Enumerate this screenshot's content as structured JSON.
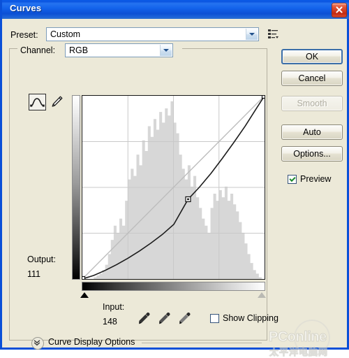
{
  "window": {
    "title": "Curves",
    "close_icon": "close-icon"
  },
  "preset": {
    "label": "Preset:",
    "value": "Custom",
    "menu_icon": "preset-menu-icon"
  },
  "channel": {
    "label": "Channel:",
    "value": "RGB"
  },
  "tools": {
    "curve_tool_icon": "curve-pen-icon",
    "pencil_tool_icon": "pencil-icon",
    "eyedropper_black_icon": "eyedropper-black-icon",
    "eyedropper_gray_icon": "eyedropper-gray-icon",
    "eyedropper_white_icon": "eyedropper-white-icon"
  },
  "readout": {
    "output_label": "Output:",
    "output_value": "111",
    "input_label": "Input:",
    "input_value": "148"
  },
  "show_clipping": {
    "label": "Show Clipping",
    "checked": false
  },
  "curve_display_options": {
    "label": "Curve Display Options",
    "expanded": false,
    "toggle_icon": "chevron-down-icon"
  },
  "buttons": {
    "ok": "OK",
    "cancel": "Cancel",
    "smooth": "Smooth",
    "auto": "Auto",
    "options": "Options...",
    "smooth_disabled": true
  },
  "preview": {
    "label": "Preview",
    "checked": true
  },
  "watermark": {
    "main": "PConline",
    "sub": "太平洋电脑网"
  },
  "colors": {
    "titlebar_blue": "#0a50d8",
    "dialog_face": "#ece9d8",
    "graph_bg": "#ffffff",
    "grid_line": "#c8c8c8",
    "histogram": "#d6d6d6",
    "curve_line": "#1a1a1a",
    "baseline": "#b4b4b4",
    "close_red": "#c22a12",
    "check_green": "#1d8b2f"
  },
  "chart_data": {
    "type": "line",
    "title": "Curves",
    "xlabel": "Input",
    "ylabel": "Output",
    "xlim": [
      0,
      255
    ],
    "ylim": [
      0,
      255
    ],
    "grid": true,
    "grid_divisions": 4,
    "legend": "none",
    "series": [
      {
        "name": "baseline-diagonal",
        "x": [
          0,
          255
        ],
        "y": [
          0,
          255
        ]
      },
      {
        "name": "tone-curve",
        "control_points": [
          [
            0,
            0
          ],
          [
            148,
            111
          ],
          [
            255,
            255
          ]
        ],
        "x": [
          0,
          16,
          32,
          48,
          64,
          80,
          96,
          112,
          128,
          148,
          164,
          180,
          196,
          212,
          228,
          244,
          255
        ],
        "y": [
          0,
          5,
          12,
          20,
          29,
          39,
          50,
          62,
          76,
          111,
          128,
          147,
          168,
          190,
          213,
          238,
          255
        ]
      }
    ],
    "annotations": [
      {
        "label": "selected-point",
        "x": 148,
        "y": 111
      },
      {
        "label": "black-point",
        "x": 0,
        "y": 0
      },
      {
        "label": "white-point",
        "x": 255,
        "y": 255
      }
    ],
    "histogram": {
      "name": "RGB luminance histogram",
      "bins": 64,
      "values": [
        0,
        0,
        0,
        0,
        1,
        2,
        3,
        5,
        8,
        14,
        22,
        30,
        26,
        34,
        30,
        44,
        56,
        62,
        58,
        70,
        64,
        78,
        72,
        86,
        80,
        90,
        84,
        94,
        88,
        96,
        92,
        100,
        88,
        82,
        70,
        62,
        56,
        64,
        52,
        58,
        46,
        40,
        34,
        30,
        26,
        40,
        48,
        44,
        50,
        46,
        52,
        44,
        48,
        42,
        38,
        32,
        26,
        20,
        14,
        9,
        5,
        3,
        1,
        0
      ]
    }
  }
}
